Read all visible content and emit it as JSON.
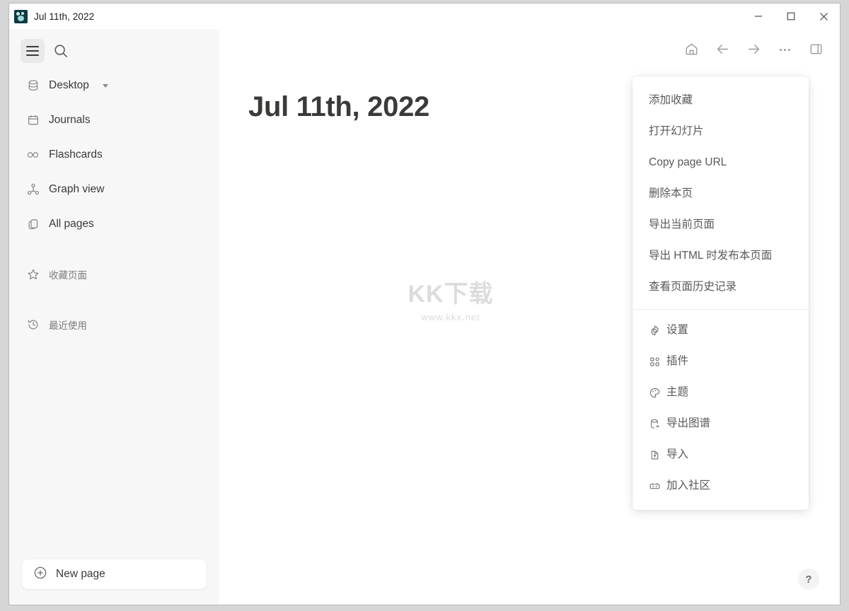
{
  "window": {
    "title": "Jul 11th, 2022",
    "app_icon": "logseq-logo-icon",
    "controls": {
      "minimize": "minimize-button",
      "maximize": "maximize-button",
      "close": "close-button"
    }
  },
  "sidebar": {
    "hamburger_label": "menu-toggle",
    "search_label": "search",
    "items": [
      {
        "label": "Desktop",
        "icon": "database-icon",
        "has_caret": true,
        "cjk": false
      },
      {
        "label": "Journals",
        "icon": "calendar-icon",
        "has_caret": false,
        "cjk": false
      },
      {
        "label": "Flashcards",
        "icon": "infinity-icon",
        "has_caret": false,
        "cjk": false
      },
      {
        "label": "Graph view",
        "icon": "graph-icon",
        "has_caret": false,
        "cjk": false
      },
      {
        "label": "All pages",
        "icon": "copy-pages-icon",
        "has_caret": false,
        "cjk": false
      }
    ],
    "favorites": {
      "label": "收藏页面",
      "icon": "star-icon"
    },
    "recent": {
      "label": "最近使用",
      "icon": "clock-history-icon"
    },
    "new_page": {
      "label": "New page",
      "icon": "plus-circle-icon"
    }
  },
  "toolbar": {
    "home": "home-icon",
    "back": "arrow-left-icon",
    "forward": "arrow-right-icon",
    "more": "dots-horizontal-icon",
    "right_sidebar": "right-sidebar-icon"
  },
  "main": {
    "page_title": "Jul 11th, 2022",
    "help_label": "?",
    "watermark": {
      "line1": "KK下载",
      "line2": "www.kkx.net"
    }
  },
  "dropdown": {
    "group1": [
      {
        "label": "添加收藏"
      },
      {
        "label": "打开幻灯片"
      },
      {
        "label": "Copy page URL"
      },
      {
        "label": "删除本页"
      },
      {
        "label": "导出当前页面"
      },
      {
        "label": "导出 HTML 时发布本页面"
      },
      {
        "label": "查看页面历史记录"
      }
    ],
    "group2": [
      {
        "label": "设置",
        "icon": "gear-icon"
      },
      {
        "label": "插件",
        "icon": "plugin-grid-icon"
      },
      {
        "label": "主题",
        "icon": "palette-icon"
      },
      {
        "label": "导出图谱",
        "icon": "database-export-icon"
      },
      {
        "label": "导入",
        "icon": "file-import-icon"
      },
      {
        "label": "加入社区",
        "icon": "discord-icon"
      }
    ]
  },
  "colors": {
    "sidebar_bg": "#f7f7f8",
    "main_bg": "#ffffff",
    "text": "#3a3a3a",
    "muted": "#8b8b8b",
    "app_icon": "#0c3b43"
  }
}
